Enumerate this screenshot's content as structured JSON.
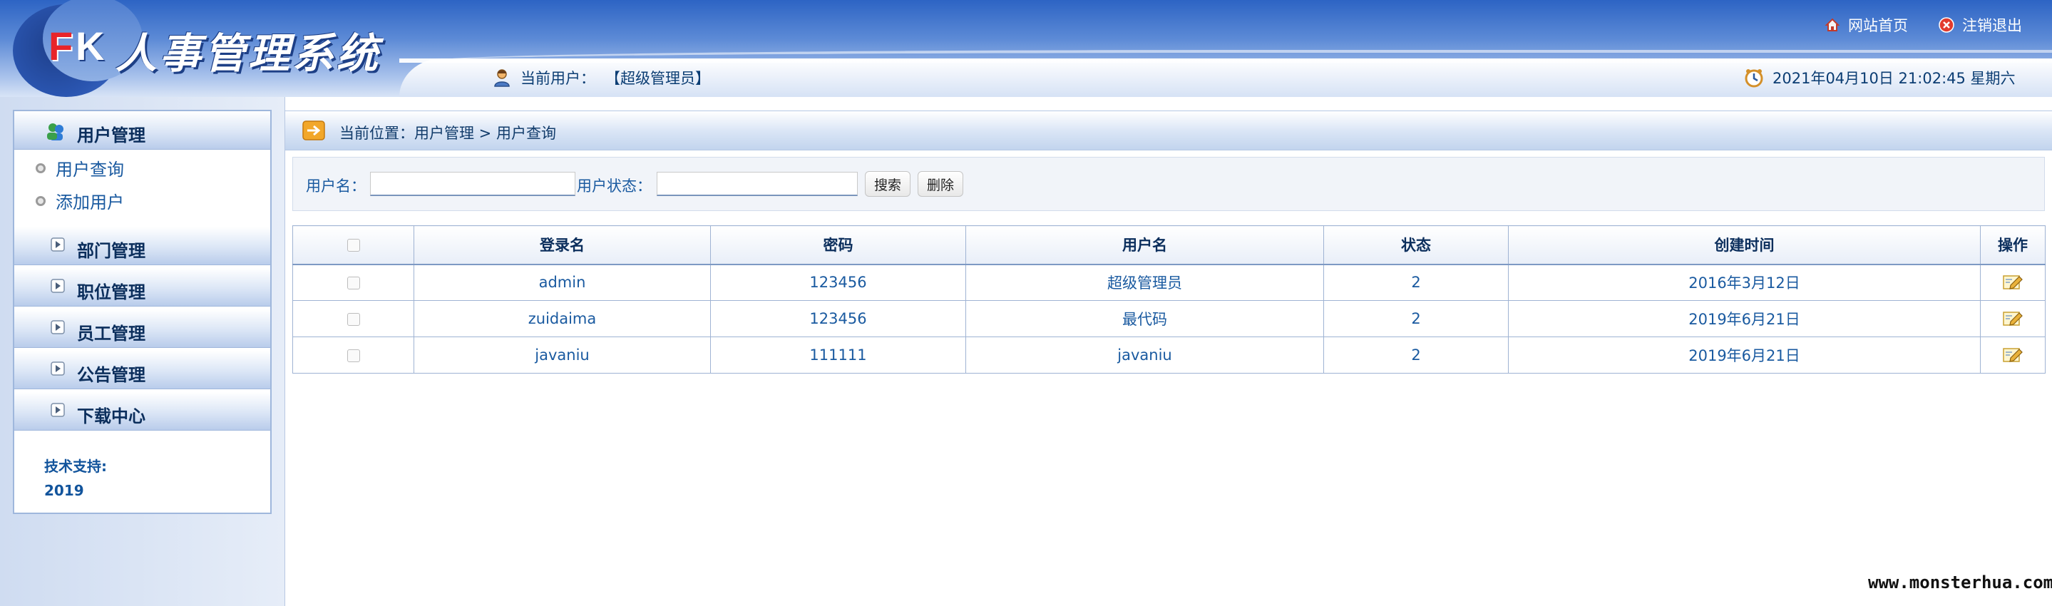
{
  "header": {
    "logo_f": "F",
    "logo_k": "K",
    "system_title": "人事管理系统",
    "home_link": "网站首页",
    "logout_link": "注销退出",
    "current_user_label": "当前用户：",
    "current_user_value": "【超级管理员】",
    "datetime": "2021年04月10日 21:02:45 星期六"
  },
  "sidebar": {
    "user_mgmt": "用户管理",
    "sub_query": "用户查询",
    "sub_add": "添加用户",
    "dept_mgmt": "部门管理",
    "pos_mgmt": "职位管理",
    "emp_mgmt": "员工管理",
    "notice_mgmt": "公告管理",
    "download": "下载中心",
    "support_label": "技术支持:",
    "support_year": "2019"
  },
  "breadcrumb": "当前位置：用户管理 > 用户查询",
  "search": {
    "username_label": "用户名：",
    "status_label": "用户状态：",
    "username_value": "",
    "status_value": "",
    "search_button": "搜索",
    "delete_button": "删除"
  },
  "table": {
    "headers": {
      "login_name": "登录名",
      "password": "密码",
      "username": "用户名",
      "status": "状态",
      "created": "创建时间",
      "action": "操作"
    },
    "rows": [
      {
        "login_name": "admin",
        "password": "123456",
        "username": "超级管理员",
        "status": "2",
        "created": "2016年3月12日"
      },
      {
        "login_name": "zuidaima",
        "password": "123456",
        "username": "最代码",
        "status": "2",
        "created": "2019年6月21日"
      },
      {
        "login_name": "javaniu",
        "password": "111111",
        "username": "javaniu",
        "status": "2",
        "created": "2019年6月21日"
      }
    ]
  },
  "watermark": "www.monsterhua.com",
  "icons": {
    "home": "home-icon",
    "logout": "close-circle-icon",
    "user": "user-icon",
    "clock": "clock-icon",
    "users": "users-group-icon",
    "expand": "expand-icon",
    "arrow": "arrow-right-icon",
    "edit": "edit-icon"
  },
  "colors": {
    "accent_text": "#1a5aa0",
    "header_blue": "#2d64c4",
    "logo_red": "#e8242a"
  }
}
